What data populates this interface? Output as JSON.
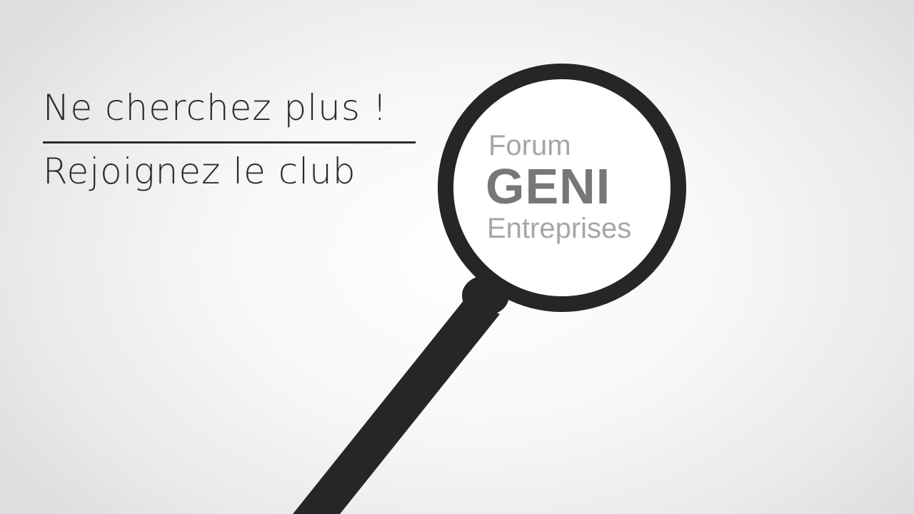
{
  "headline": {
    "line1": "Ne cherchez plus !",
    "line2": "Rejoignez le club"
  },
  "logo": {
    "word1": "Forum",
    "word2": "GENI",
    "word3": "Entreprises"
  },
  "colors": {
    "ink": "#2b2b2b",
    "lens_fill": "#ffffff",
    "logo_light": "#a6a6a6",
    "logo_dark": "#777777"
  },
  "icons": {
    "magnifier": "magnifying-glass-icon"
  }
}
